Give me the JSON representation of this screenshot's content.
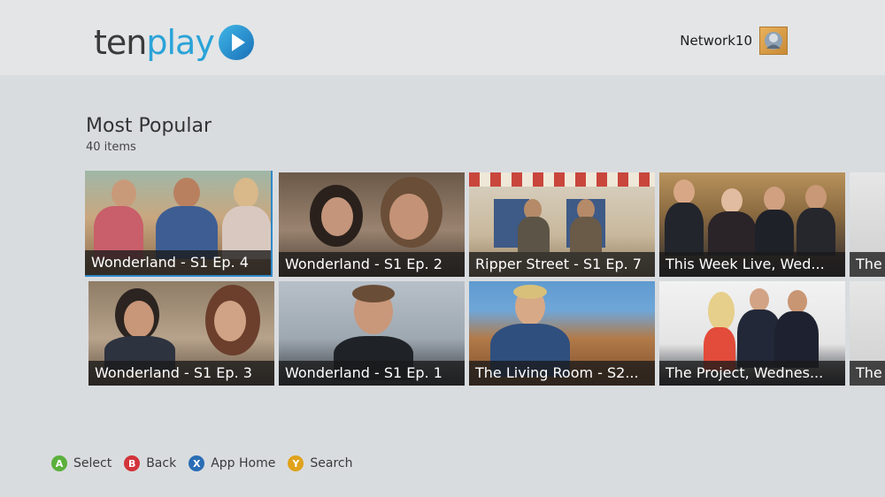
{
  "app": {
    "logo_ten": "ten",
    "logo_play": "play",
    "brand_colors": {
      "ten": "#3a3a3a",
      "play": "#2aa3d8"
    }
  },
  "account": {
    "name": "Network10",
    "avatar_icon": "gamer-picture-icon"
  },
  "section": {
    "title": "Most Popular",
    "count": "40 items"
  },
  "tiles": [
    {
      "title": "Wonderland - S1 Ep. 4",
      "selected": true
    },
    {
      "title": "Wonderland - S1 Ep. 2"
    },
    {
      "title": "Ripper Street - S1 Ep. 7"
    },
    {
      "title": "This Week Live, Wed..."
    },
    {
      "title": "The"
    },
    {
      "title": "Wonderland - S1 Ep. 3"
    },
    {
      "title": "Wonderland - S1 Ep. 1"
    },
    {
      "title": "The Living Room - S2..."
    },
    {
      "title": "The Project, Wednes..."
    },
    {
      "title": "The"
    }
  ],
  "controls": [
    {
      "key": "A",
      "label": "Select",
      "color": "#5bb03c"
    },
    {
      "key": "B",
      "label": "Back",
      "color": "#d2343a"
    },
    {
      "key": "X",
      "label": "App Home",
      "color": "#2a6db5"
    },
    {
      "key": "Y",
      "label": "Search",
      "color": "#e0a21b"
    }
  ]
}
